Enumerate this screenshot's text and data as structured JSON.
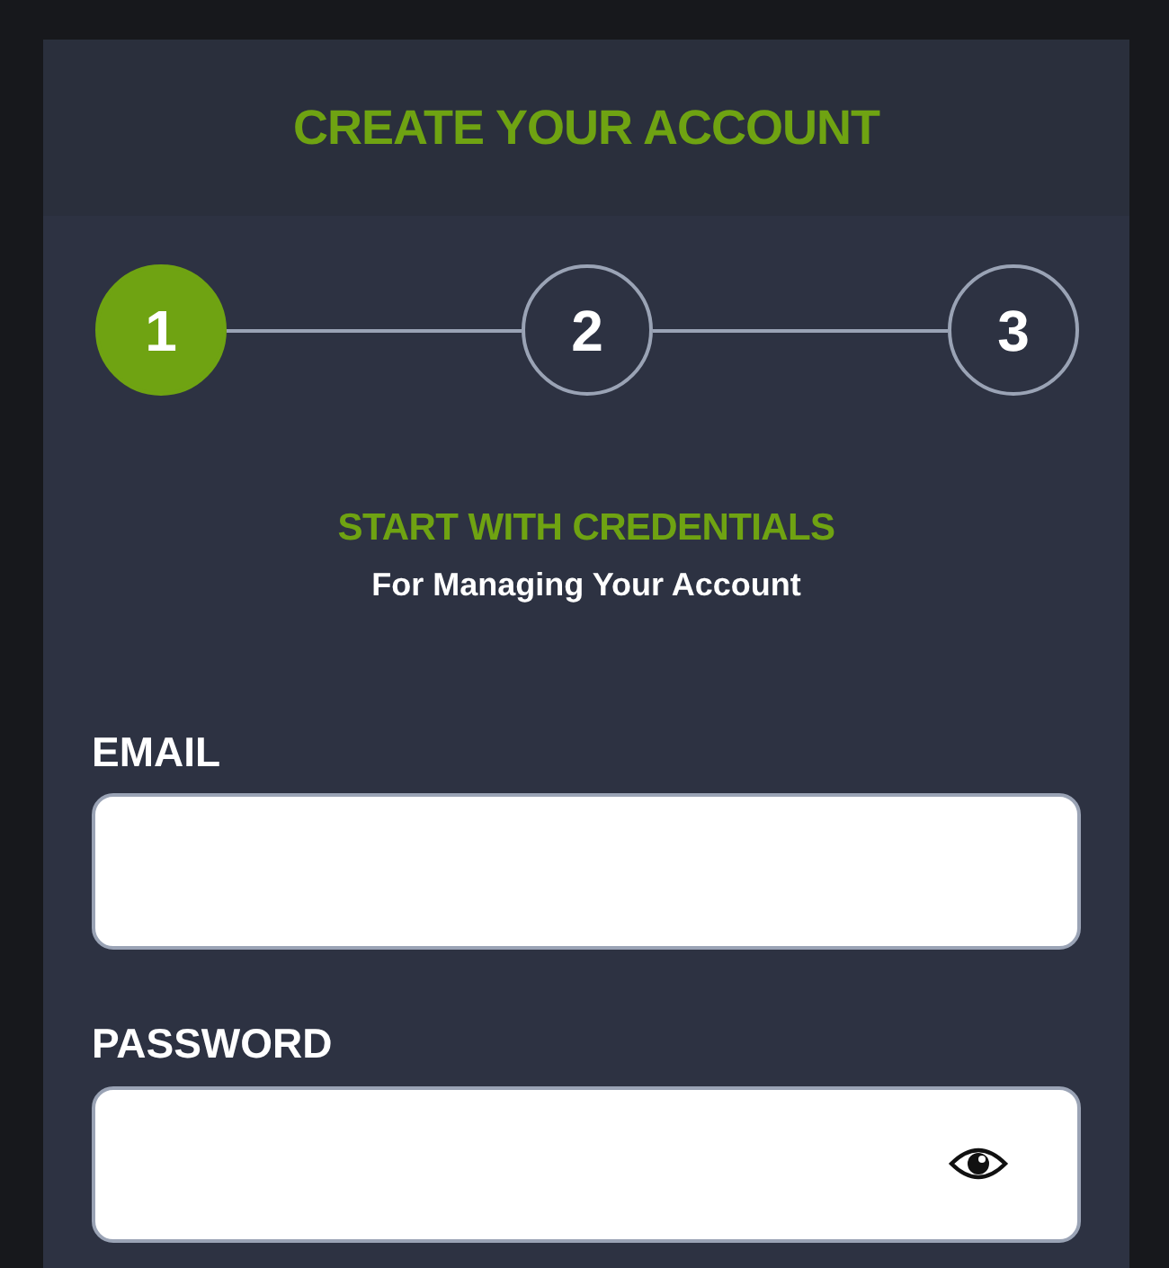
{
  "header": {
    "title": "CREATE YOUR ACCOUNT"
  },
  "steps": [
    {
      "label": "1",
      "selected": true
    },
    {
      "label": "2",
      "selected": false
    },
    {
      "label": "3",
      "selected": false
    }
  ],
  "intro": {
    "heading": "START WITH CREDENTIALS",
    "subheading": "For Managing Your Account"
  },
  "fields": [
    {
      "kind": "email",
      "label": "EMAIL"
    },
    {
      "kind": "password",
      "label": "PASSWORD"
    }
  ]
}
